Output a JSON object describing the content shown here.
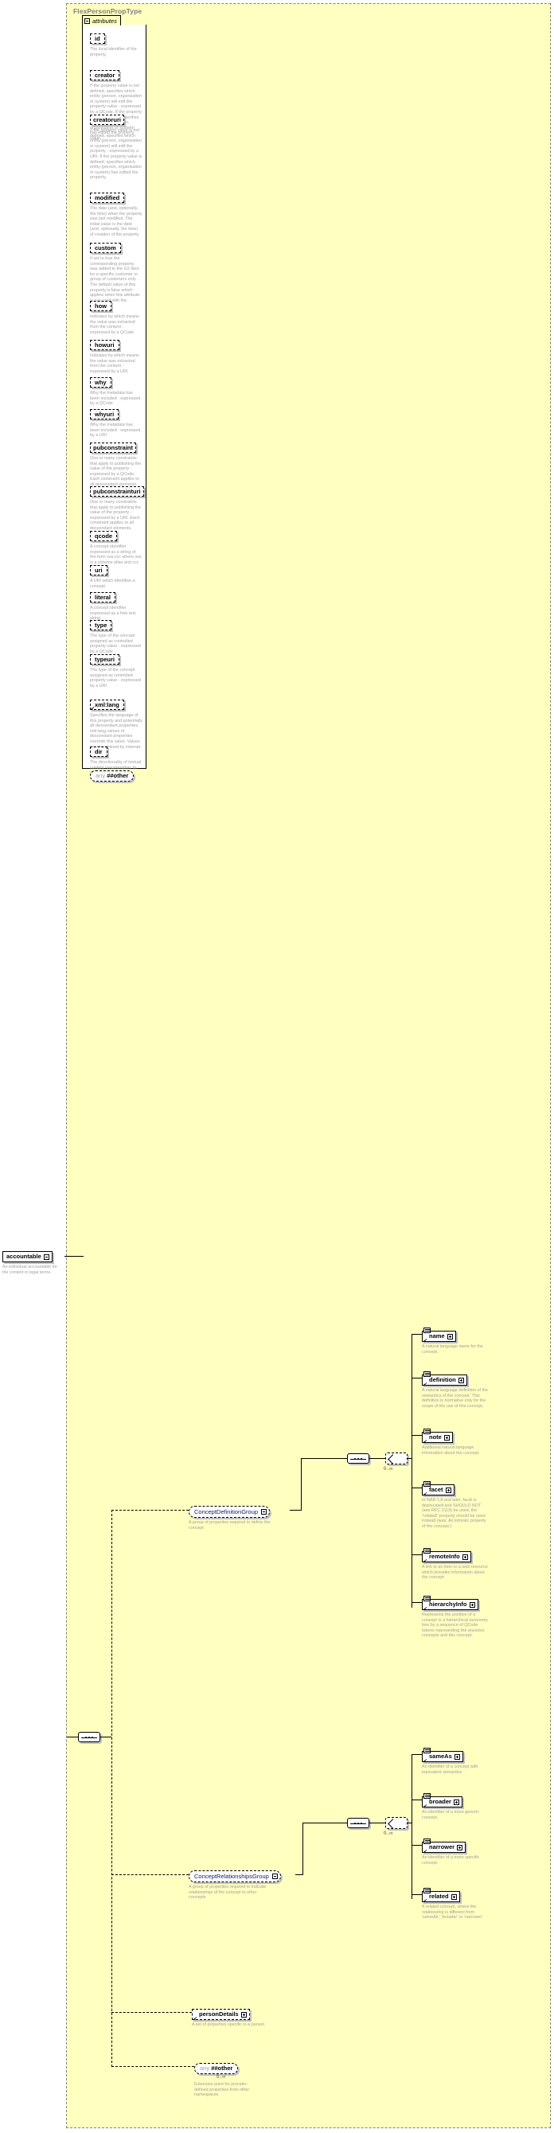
{
  "diagram": {
    "type_name": "FlexPersonPropType",
    "attributes_label": "attributes",
    "colors": {
      "panel_bg": "#ffffc0",
      "box_bg": "#ffffff",
      "desc_text": "#a0a0a0",
      "group_text": "#1a1a5e",
      "line": "#000000"
    }
  },
  "attributes": [
    {
      "name": "id",
      "desc": "The local identifier of the property."
    },
    {
      "name": "creator",
      "desc": "If the property value is not defined, specifies which entity (person, organisation or system) will edit the property value - expressed by a QCode. If the property value is defined, specifies which entity (person, organisation or system) has edited the property value."
    },
    {
      "name": "creatoruri",
      "desc": "If the property value is not defined, specifies which entity (person, organisation or system) will edit the property - expressed by a URI. If the property value is defined, specifies which entity (person, organisation or system) has edited the property."
    },
    {
      "name": "modified",
      "desc": "The date (and, optionally, the time) when the property was last modified. The initial value is the date (and, optionally, the time) of creation of the property."
    },
    {
      "name": "custom",
      "desc": "If set to true the corresponding property was added to the G2 Item for a specific customer or group of customers only. The default value of this property is false which applies when this attribute is not used with the property."
    },
    {
      "name": "how",
      "desc": "Indicates by which means the value was extracted from the content - expressed by a QCode"
    },
    {
      "name": "howuri",
      "desc": "Indicates by which means the value was extracted from the content - expressed by a URI"
    },
    {
      "name": "why",
      "desc": "Why the metadata has been included - expressed by a QCode"
    },
    {
      "name": "whyuri",
      "desc": "Why the metadata has been included - expressed by a URI"
    },
    {
      "name": "pubconstraint",
      "desc": "One or many constraints that apply to publishing the value of the property - expressed by a QCode. Each constraint applies to all descendant elements."
    },
    {
      "name": "pubconstrainturi",
      "desc": "One or many constraints that apply to publishing the value of the property - expressed by a URI. Each constraint applies to all descendant elements."
    },
    {
      "name": "qcode",
      "desc": "A concept identifier expressed as a string of the form sss:ccc where sss is a scheme alias and ccc is a code"
    },
    {
      "name": "uri",
      "desc": "A URI which identifies a concept."
    },
    {
      "name": "literal",
      "desc": "A concept identifier expressed as a free text string"
    },
    {
      "name": "type",
      "desc": "The type of the concept assigned as controlled property value - expressed by a QCode"
    },
    {
      "name": "typeuri",
      "desc": "The type of the concept assigned as controlled property value - expressed by a URI"
    },
    {
      "name": "xml:lang",
      "desc": "Specifies the language of this property and potentially all descendant properties. xml:lang values of descendant properties override this value. Values are determined by Internet BCP 47."
    },
    {
      "name": "dir",
      "desc": "The directionality of textual content (enumeration: ltr, rtl)"
    }
  ],
  "any_attribute": {
    "any_label": "any",
    "namespace": "##other"
  },
  "accountable": {
    "name": "accountable",
    "desc": "An individual accountable for the content in legal terms."
  },
  "groups": {
    "concept_definition": {
      "name": "ConceptDefinitionGroup",
      "desc": "A group of properites required to define the concept",
      "occurs": "0..∞",
      "children": [
        {
          "name": "name",
          "desc": "A natural language name for the concept."
        },
        {
          "name": "definition",
          "desc": "A natural language definition of the semantics of the concept. This definition is normative only for the scope of the use of this concept."
        },
        {
          "name": "note",
          "desc": "Additional natural language information about the concept."
        },
        {
          "name": "facet",
          "desc": "In NAR 1.8 and later, facet is deprecated and SHOULD NOT (see RFC 2119) be used, the \"related\" property should be used instead (was: An intrinsic property of the concept.)"
        },
        {
          "name": "remoteInfo",
          "desc": "A link to an item or a web resource which provides information about the concept"
        },
        {
          "name": "hierarchyInfo",
          "desc": "Represents the position of a concept in a hierarchical taxonomy tree by a sequence of QCode tokens representing the ancestor concepts and this concept."
        }
      ]
    },
    "concept_relationships": {
      "name": "ConceptRelationshipsGroup",
      "desc": "A group of properites required to indicate relationships of the concept to other concepts",
      "occurs": "0..∞",
      "children": [
        {
          "name": "sameAs",
          "desc": "An identifier of a concept with equivalent semantics"
        },
        {
          "name": "broader",
          "desc": "An identifier of a more generic concept."
        },
        {
          "name": "narrower",
          "desc": "An identifier of a more specific concept."
        },
        {
          "name": "related",
          "desc": "A related concept, where the relationship is different from 'sameAs', 'broader' or 'narrower'"
        }
      ]
    }
  },
  "person_details": {
    "name": "personDetails",
    "desc": "A set of properties specific to a person"
  },
  "any_element": {
    "any_label": "any",
    "namespace": "##other",
    "occurs": "0..∞",
    "desc": "Extension point for provider-defined properties from other namespaces"
  }
}
